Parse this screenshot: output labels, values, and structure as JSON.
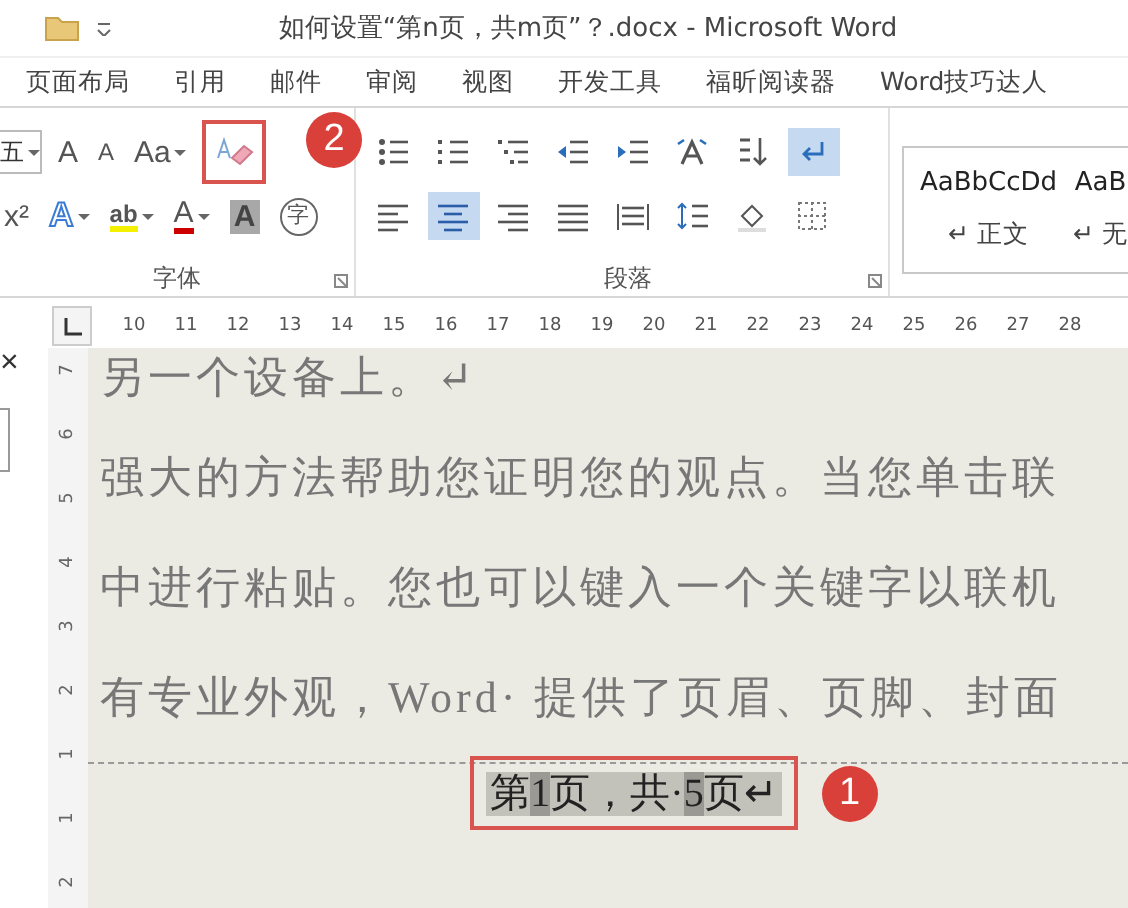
{
  "window": {
    "title": "如何设置“第n页，共m页”？.docx - Microsoft Word"
  },
  "tabs": [
    {
      "label": "页面布局"
    },
    {
      "label": "引用"
    },
    {
      "label": "邮件"
    },
    {
      "label": "审阅"
    },
    {
      "label": "视图"
    },
    {
      "label": "开发工具"
    },
    {
      "label": "福昕阅读器"
    },
    {
      "label": "Word技巧达人"
    }
  ],
  "font_group": {
    "label": "字体",
    "font_size": "五",
    "row1": [
      {
        "kind": "plain",
        "label": "A"
      },
      {
        "kind": "small",
        "label": "A"
      },
      {
        "kind": "case",
        "label": "Aa"
      }
    ],
    "row2": [
      {
        "kind": "superscript",
        "label": "x²"
      },
      {
        "kind": "text-effect",
        "label": "A"
      },
      {
        "kind": "highlight",
        "label": "ab"
      },
      {
        "kind": "font-color",
        "label": "A"
      },
      {
        "kind": "shading",
        "label": "A"
      },
      {
        "kind": "enclosed",
        "label": "字"
      }
    ]
  },
  "paragraph_group": {
    "label": "段落",
    "row1": [
      {
        "kind": "bullets",
        "pressed": false
      },
      {
        "kind": "numbering",
        "pressed": false
      },
      {
        "kind": "multilevel",
        "pressed": false
      },
      {
        "kind": "outdent",
        "pressed": false
      },
      {
        "kind": "indent",
        "pressed": false
      },
      {
        "kind": "asian-layout",
        "pressed": false
      },
      {
        "kind": "sort",
        "pressed": false
      },
      {
        "kind": "marks",
        "pressed": true
      }
    ],
    "row2": [
      {
        "kind": "align-left",
        "pressed": false
      },
      {
        "kind": "align-center",
        "pressed": true
      },
      {
        "kind": "align-right",
        "pressed": false
      },
      {
        "kind": "justify",
        "pressed": false
      },
      {
        "kind": "distribute",
        "pressed": false
      },
      {
        "kind": "line-spacing",
        "pressed": false
      },
      {
        "kind": "fill",
        "pressed": false
      },
      {
        "kind": "borders",
        "pressed": false
      }
    ]
  },
  "styles": [
    {
      "sample": "AaBbCcDd",
      "name": "↵ 正文"
    },
    {
      "sample": "AaB",
      "name": "↵ 无"
    }
  ],
  "ruler": {
    "h": [
      "10",
      "11",
      "12",
      "13",
      "14",
      "15",
      "16",
      "17",
      "18",
      "19",
      "20",
      "21",
      "22",
      "23",
      "24",
      "25",
      "26",
      "27",
      "28"
    ],
    "v": [
      "7",
      "6",
      "5",
      "4",
      "3",
      "2",
      "1",
      "1",
      "2"
    ]
  },
  "document": {
    "lines": [
      "另一个设备上。↵",
      "强大的方法帮助您证明您的观点。当您单击联",
      "中进行粘贴。您也可以键入一个关键字以联机",
      "有专业外观，Word· 提供了页眉、页脚、封面"
    ],
    "footer": [
      {
        "text": "第",
        "field": false
      },
      {
        "text": "1",
        "field": true
      },
      {
        "text": "页，共·",
        "field": false
      },
      {
        "text": "5",
        "field": true
      },
      {
        "text": "页↵",
        "field": false
      }
    ]
  },
  "side": {
    "close": "×"
  },
  "annotations": [
    {
      "label": "1"
    },
    {
      "label": "2"
    }
  ]
}
